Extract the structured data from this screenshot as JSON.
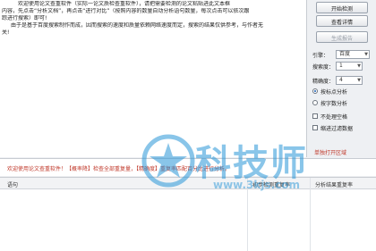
{
  "document": {
    "lines": [
      "欢迎使用论文查重软件（实际一论文质检查重软件），请把需要检测的论文粘贴进此文本框",
      "内容，先点击“分析文档”，再点击“进行对比”（按照内容的数量自动分析语句数量，每次点击可以依次跟",
      "踪进行搜索）即可!",
      "由于是基于百度搜索制作而成，因而搜索的速度和质量依赖网络速度而定，搜索的结果仅供参考，与作者无",
      "关!"
    ]
  },
  "sidebar": {
    "buttons": {
      "analyze": "开始检测",
      "view_details": "查看详情",
      "generate_report": "生成报告"
    },
    "engine_label": "引擎：",
    "engine_value": "百度",
    "depth_label": "搜索度：",
    "depth_value": "1",
    "precision_label": "精确度：",
    "precision_value": "4",
    "radio_options": [
      "按标点分析",
      "按字数分析"
    ],
    "checkbox_options": [
      "不处理空格",
      "缩进过滤数据"
    ],
    "link_text": "单独打开区域"
  },
  "status": {
    "message": "欢迎使用论文查重软件！【概率降】检查全部重复量，【精确度】重复率匹配百分比进行分析。"
  },
  "table": {
    "columns": [
      "语句",
      "初步检测重复率",
      "分析结果重复率"
    ]
  },
  "watermark": {
    "brand": "科技师",
    "url": "www.3kjs.com"
  },
  "colors": {
    "accent": "#2a96d7",
    "status_text": "#c0392b"
  }
}
